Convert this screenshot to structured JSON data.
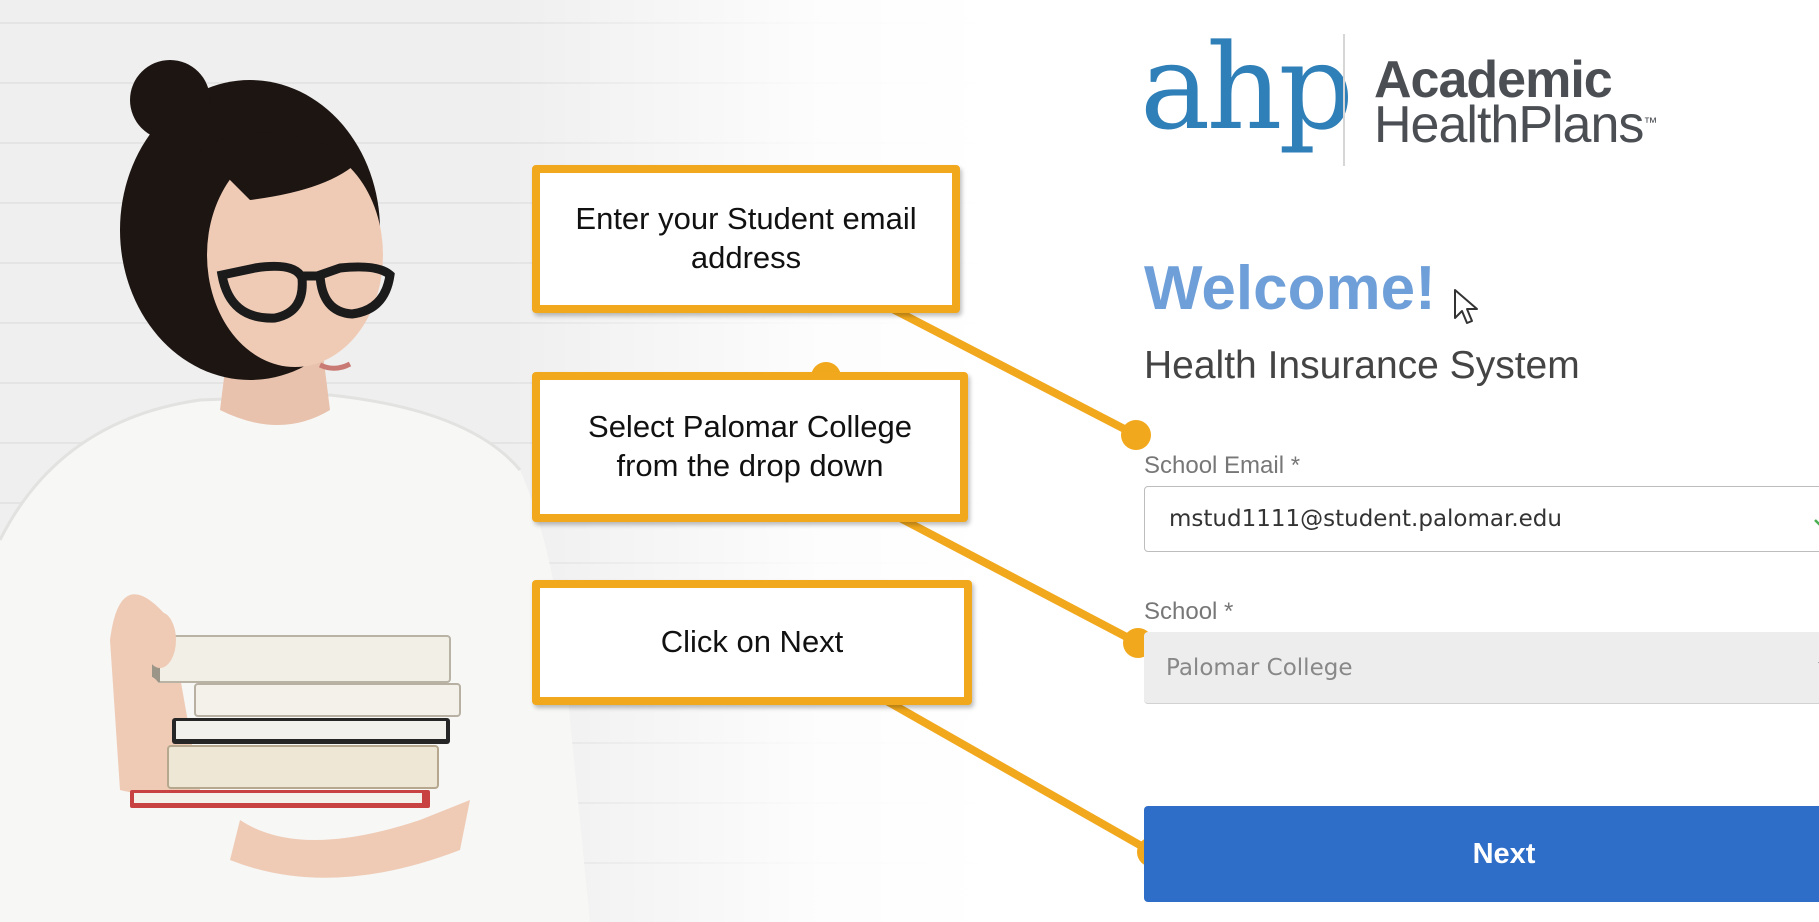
{
  "logo": {
    "mark": "ahp",
    "line1": "Academic",
    "line2": "HealthPlans",
    "tm": "™"
  },
  "header": {
    "welcome": "Welcome!",
    "subtitle": "Health Insurance System"
  },
  "form": {
    "email_label": "School Email *",
    "email_value": "mstud1111@student.palomar.edu",
    "school_label": "School *",
    "school_value": "Palomar College",
    "next_label": "Next"
  },
  "callouts": {
    "email": "Enter your Student email address",
    "school": "Select Palomar College from the drop down",
    "next": "Click on Next"
  },
  "colors": {
    "callout_border": "#f1a81c",
    "brand_blue": "#2f7fb8",
    "welcome_blue": "#6f9fd8",
    "button_blue": "#2f6ec8",
    "check_green": "#4caf50"
  },
  "icons": {
    "check": "check-icon",
    "caret": "caret-down-icon",
    "cursor": "mouse-pointer-icon"
  }
}
